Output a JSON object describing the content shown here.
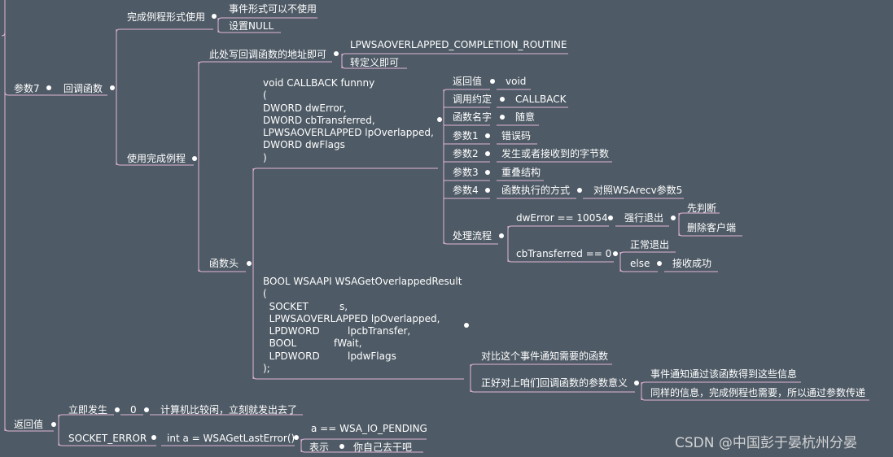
{
  "mindmap": {
    "param7": "参数7",
    "callback_func": "回调函数",
    "completion_form": "完成例程形式使用",
    "event_form_unusable": "事件形式可以不使用",
    "set_null": "设置NULL",
    "use_completion": "使用完成例程",
    "fill_address": "此处写回调函数的地址即可",
    "routine_type": "LPWSAOVERLAPPED_COMPLETION_ROUTINE",
    "typedef": "转定义即可",
    "func_header": "函数头",
    "callback_code": "void CALLBACK funnny\n(\nDWORD dwError,\nDWORD cbTransferred,\nLPWSAOVERLAPPED lpOverlapped,\nDWORD dwFlags\n)",
    "ret_value": "返回值",
    "void": "void",
    "calling_conv": "调用约定",
    "callback_kw": "CALLBACK",
    "func_name": "函数名字",
    "anything": "随意",
    "arg1": "参数1",
    "error_code": "错误码",
    "arg2": "参数2",
    "bytes_transferred": "发生或者接收到的字节数",
    "arg3": "参数3",
    "overlapped_struct": "重叠结构",
    "arg4": "参数4",
    "exec_mode": "函数执行的方式",
    "compare_wsarecv": "对照WSArecv参数5",
    "process_flow": "处理流程",
    "dwerror_cond": "dwError == 10054",
    "force_exit": "强行退出",
    "check_first": "先判断",
    "delete_client": "删除客户端",
    "cbtransferred_cond": "cbTransferred == 0",
    "normal_exit": "正常退出",
    "else_kw": "else",
    "recv_success": "接收成功",
    "getoverlapped_code": "BOOL WSAAPI WSAGetOverlappedResult\n(\n  SOCKET          s,\n  LPWSAOVERLAPPED lpOverlapped,\n  LPDWORD         lpcbTransfer,\n  BOOL            fWait,\n  LPDWORD         lpdwFlags\n);",
    "compare_event_func": "对比这个事件通知需要的函数",
    "matches_callback": "正好对上咱们回调函数的参数意义",
    "event_gets_info": "事件通知通过该函数得到这些信息",
    "same_info": "同样的信息，完成例程也需要，所以通过参数传递",
    "return_value": "返回值",
    "immediate": "立即发生",
    "zero": "0",
    "computer_idle": "计算机比较闲，立刻就发出去了",
    "socket_error": "SOCKET_ERROR",
    "get_last_error": "int a = WSAGetLastError()",
    "io_pending": "a == WSA_IO_PENDING",
    "means": "表示",
    "go_do_yourself": "你自己去干吧"
  },
  "watermark": "CSDN @中国彭于晏杭州分晏",
  "colors": {
    "background": "#4e5a65",
    "line": "#e3b6d6",
    "text": "#ffffff"
  }
}
